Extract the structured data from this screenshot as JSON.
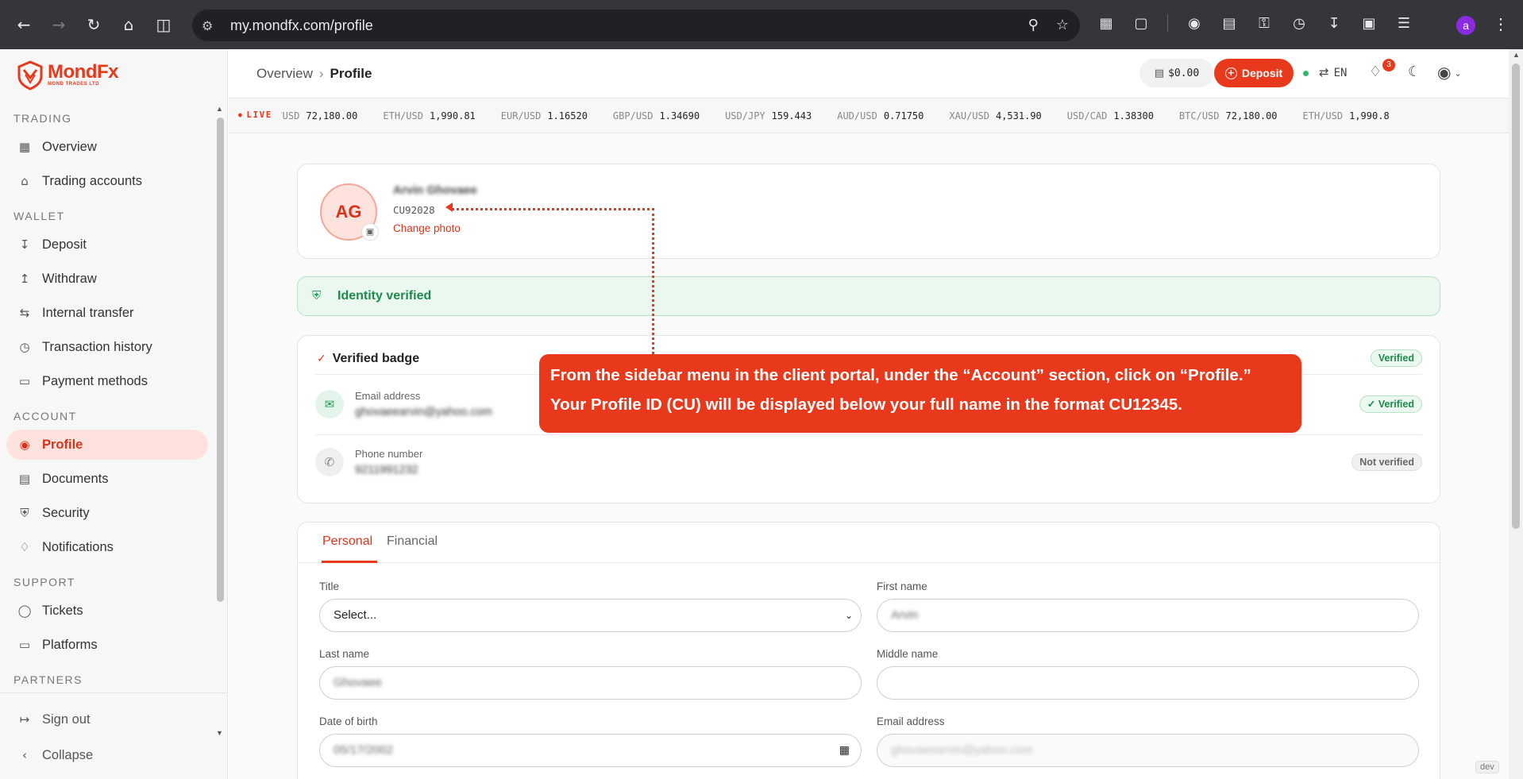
{
  "browser": {
    "url": "my.mondfx.com/profile",
    "profile_initial": "a"
  },
  "brand": {
    "name": "MondFx",
    "tagline": "MOND TRADES LTD",
    "accent_color": "#e8391d"
  },
  "sidebar": {
    "sections": {
      "trading": "TRADING",
      "wallet": "WALLET",
      "account": "ACCOUNT",
      "support": "SUPPORT",
      "partners": "PARTNERS"
    },
    "items": {
      "overview": "Overview",
      "trading_accounts": "Trading accounts",
      "deposit": "Deposit",
      "withdraw": "Withdraw",
      "internal_transfer": "Internal transfer",
      "transaction_history": "Transaction history",
      "payment_methods": "Payment methods",
      "profile": "Profile",
      "documents": "Documents",
      "security": "Security",
      "notifications": "Notifications",
      "tickets": "Tickets",
      "platforms": "Platforms"
    },
    "bottom": {
      "sign_out": "Sign out",
      "collapse": "Collapse"
    }
  },
  "header": {
    "breadcrumb_root": "Overview",
    "breadcrumb_current": "Profile",
    "balance": "$0.00",
    "deposit_label": "Deposit",
    "language": "EN",
    "notification_count": "3"
  },
  "ticker": {
    "live_label": "LIVE",
    "pairs": [
      {
        "symbol": "TC/USD",
        "price": "72,180.00"
      },
      {
        "symbol": "ETH/USD",
        "price": "1,990.81"
      },
      {
        "symbol": "EUR/USD",
        "price": "1.16520"
      },
      {
        "symbol": "GBP/USD",
        "price": "1.34690"
      },
      {
        "symbol": "USD/JPY",
        "price": "159.443"
      },
      {
        "symbol": "AUD/USD",
        "price": "0.71750"
      },
      {
        "symbol": "XAU/USD",
        "price": "4,531.90"
      },
      {
        "symbol": "USD/CAD",
        "price": "1.38300"
      },
      {
        "symbol": "BTC/USD",
        "price": "72,180.00"
      },
      {
        "symbol": "ETH/USD",
        "price": "1,990.8"
      }
    ]
  },
  "profile_card": {
    "initials": "AG",
    "full_name": "Arvin Ghovaee",
    "profile_id": "CU92028",
    "change_photo": "Change photo"
  },
  "identity": {
    "status_text": "Identity verified"
  },
  "verified_badge": {
    "title": "Verified badge",
    "status": "Verified",
    "email_label": "Email address",
    "email_value": "ghovaeearvin@yahoo.com",
    "email_status": "Verified",
    "phone_label": "Phone number",
    "phone_value": "9211991232",
    "phone_status": "Not verified"
  },
  "form": {
    "tabs": {
      "personal": "Personal",
      "financial": "Financial"
    },
    "title_label": "Title",
    "title_value": "Select...",
    "first_name_label": "First name",
    "first_name_value": "Arvin",
    "last_name_label": "Last name",
    "last_name_value": "Ghovaee",
    "middle_name_label": "Middle name",
    "middle_name_value": "",
    "dob_label": "Date of birth",
    "dob_value": "05/17/2002",
    "email_label": "Email address",
    "email_value": "ghovaeearvin@yahoo.com"
  },
  "annotation": {
    "line1": "From the sidebar menu in the client portal, under the “Account” section, click on “Profile.”",
    "line2": "Your Profile ID (CU) will be displayed below your full name in the format CU12345."
  },
  "footer": {
    "dev_tag": "dev"
  }
}
